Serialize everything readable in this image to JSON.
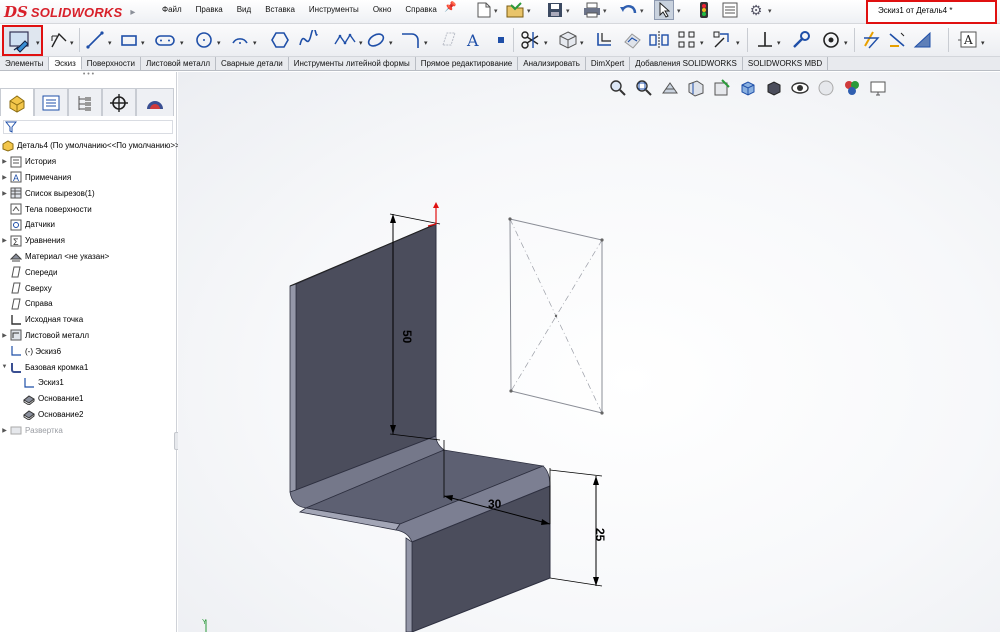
{
  "app": {
    "logo_prefix": "DS",
    "logo_name": "SOLIDWORKS",
    "menu": [
      "Файл",
      "Правка",
      "Вид",
      "Вставка",
      "Инструменты",
      "Окно",
      "Справка"
    ],
    "document_title": "Эскиз1 от Деталь4 *"
  },
  "toolbar": {
    "icons": [
      "sketch-icon",
      "smart-dimension-icon",
      "line-icon",
      "rectangle-icon",
      "slot-icon",
      "circle-icon",
      "arc-icon",
      "polygon-icon",
      "spline-icon",
      "ellipse-icon",
      "fillet-icon",
      "plane-icon",
      "text-icon",
      "point-icon",
      "trim-icon",
      "convert-entities-icon",
      "offset-entities-icon",
      "offset-on-surface-icon",
      "mirror-icon",
      "linear-pattern-icon",
      "move-icon",
      "display-relations-icon",
      "repair-sketch-icon",
      "quick-snaps-icon",
      "rapid-sketch-icon",
      "instant2d-icon",
      "shaded-sketch-contours-icon",
      "note-icon"
    ]
  },
  "tabs": [
    {
      "label": "Элементы",
      "active": false
    },
    {
      "label": "Эскиз",
      "active": true
    },
    {
      "label": "Поверхности",
      "active": false
    },
    {
      "label": "Листовой металл",
      "active": false
    },
    {
      "label": "Сварные детали",
      "active": false
    },
    {
      "label": "Инструменты литейной формы",
      "active": false
    },
    {
      "label": "Прямое редактирование",
      "active": false
    },
    {
      "label": "Анализировать",
      "active": false
    },
    {
      "label": "DimXpert",
      "active": false
    },
    {
      "label": "Добавления SOLIDWORKS",
      "active": false
    },
    {
      "label": "SOLIDWORKS MBD",
      "active": false
    }
  ],
  "feature_manager": {
    "root": "Деталь4  (По умолчанию<<По умолчанию>>)",
    "items": [
      {
        "label": "История",
        "icon": "history-icon",
        "expandable": true,
        "indent": 0
      },
      {
        "label": "Примечания",
        "icon": "annotations-icon",
        "expandable": true,
        "indent": 0
      },
      {
        "label": "Список вырезов(1)",
        "icon": "cut-list-icon",
        "expandable": true,
        "indent": 0
      },
      {
        "label": "Тела поверхности",
        "icon": "surface-bodies-icon",
        "expandable": false,
        "indent": 0
      },
      {
        "label": "Датчики",
        "icon": "sensors-icon",
        "expandable": false,
        "indent": 0
      },
      {
        "label": "Уравнения",
        "icon": "equations-icon",
        "expandable": true,
        "indent": 0
      },
      {
        "label": "Материал <не указан>",
        "icon": "material-icon",
        "expandable": false,
        "indent": 0
      },
      {
        "label": "Спереди",
        "icon": "plane-icon",
        "expandable": false,
        "indent": 0
      },
      {
        "label": "Сверху",
        "icon": "plane-icon",
        "expandable": false,
        "indent": 0
      },
      {
        "label": "Справа",
        "icon": "plane-icon",
        "expandable": false,
        "indent": 0
      },
      {
        "label": "Исходная точка",
        "icon": "origin-icon",
        "expandable": false,
        "indent": 0
      },
      {
        "label": "Листовой металл",
        "icon": "sheet-metal-icon",
        "expandable": true,
        "indent": 0
      },
      {
        "label": "(-) Эскиз6",
        "icon": "sketch-icon",
        "expandable": false,
        "indent": 0
      },
      {
        "label": "Базовая кромка1",
        "icon": "base-flange-icon",
        "expandable": true,
        "expanded": true,
        "indent": 0
      },
      {
        "label": "Эскиз1",
        "icon": "sketch-icon",
        "expandable": false,
        "indent": 1
      },
      {
        "label": "Основание1",
        "icon": "fixed-face-icon",
        "expandable": false,
        "indent": 1
      },
      {
        "label": "Основание2",
        "icon": "fixed-face-icon",
        "expandable": false,
        "indent": 1
      },
      {
        "label": "Развертка",
        "icon": "flat-pattern-icon",
        "expandable": true,
        "indent": 0,
        "dim": true
      }
    ]
  },
  "viewport": {
    "dimensions": {
      "vertical_height": "50",
      "horizontal_width": "30",
      "lower_height": "25"
    },
    "colors": {
      "body_face": "#4b4d5c",
      "body_top": "#6b6e80",
      "body_edge": "#8a8da0",
      "bend": "#75788a"
    }
  }
}
